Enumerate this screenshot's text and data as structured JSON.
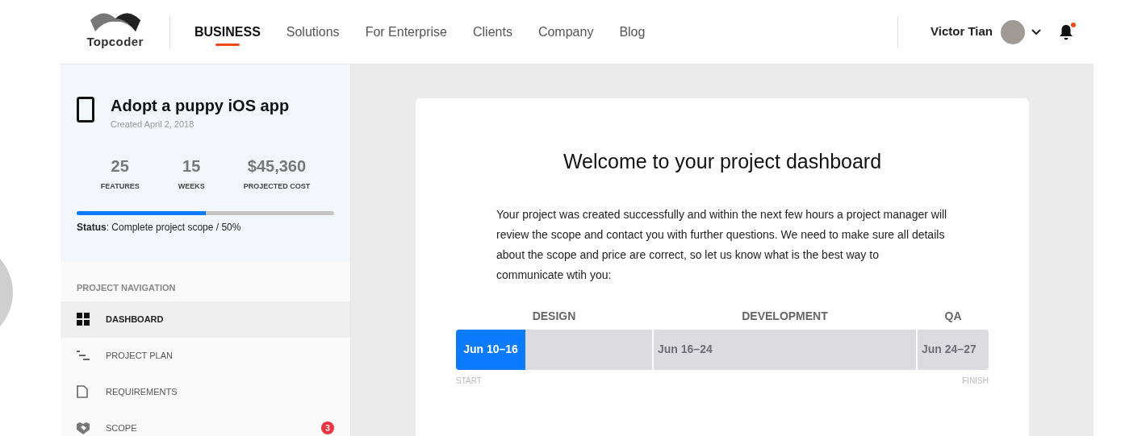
{
  "header": {
    "logo_text": "Topcoder",
    "nav": [
      {
        "label": "BUSINESS",
        "selected": true
      },
      {
        "label": "Solutions",
        "selected": false
      },
      {
        "label": "For Enterprise",
        "selected": false
      },
      {
        "label": "Clients",
        "selected": false
      },
      {
        "label": "Company",
        "selected": false
      },
      {
        "label": "Blog",
        "selected": false
      }
    ],
    "user_name": "Victor Tian",
    "has_notifications": true
  },
  "project": {
    "title": "Adopt a puppy iOS app",
    "created": "Created April 2, 2018",
    "stats": [
      {
        "value": "25",
        "label": "FEATURES"
      },
      {
        "value": "15",
        "label": "WEEKS"
      },
      {
        "value": "$45,360",
        "label": "PROJECTED COST"
      }
    ],
    "progress": {
      "level": 0.5
    },
    "status_label": "Status",
    "status_text": ": Complete project scope / 50%"
  },
  "navigation": {
    "heading": "PROJECT NAVIGATION",
    "items": [
      {
        "kind": "dashboard",
        "label": "DASHBOARD",
        "selected": true
      },
      {
        "kind": "plan",
        "label": "PROJECT PLAN",
        "selected": false
      },
      {
        "kind": "requirements",
        "label": "REQUIREMENTS",
        "selected": false
      },
      {
        "kind": "scope",
        "label": "SCOPE",
        "selected": false,
        "badge": "3"
      }
    ]
  },
  "welcome": {
    "title": "Welcome to your project dashboard",
    "body": "Your project was created successfully and within the next few hours a project manager will review the scope and contact you with further questions. We need to make sure all details about the scope and price are correct, so let us know what is the best way to communicate wtih you:"
  },
  "timeline": {
    "phases": [
      {
        "name": "DESIGN",
        "dates": "Jun 10–16",
        "active": true
      },
      {
        "name": "DEVELOPMENT",
        "dates": "Jun 16–24",
        "active": false
      },
      {
        "name": "QA",
        "dates": "Jun 24–27",
        "active": false
      }
    ],
    "start_label": "START",
    "finish_label": "FINISH"
  }
}
